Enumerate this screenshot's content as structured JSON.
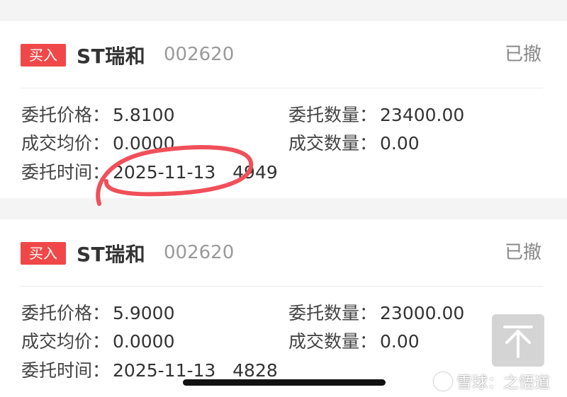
{
  "orders": [
    {
      "side": "买入",
      "name": "ST瑞和",
      "code": "002620",
      "status": "已撤",
      "price_label": "委托价格：",
      "price": "5.8100",
      "qty_label": "委托数量：",
      "qty": "23400.00",
      "avg_label": "成交均价：",
      "avg": "0.0000",
      "filled_label": "成交数量：",
      "filled": "0.00",
      "time_label": "委托时间：",
      "time": "2025-11-13   4949"
    },
    {
      "side": "买入",
      "name": "ST瑞和",
      "code": "002620",
      "status": "已撤",
      "price_label": "委托价格：",
      "price": "5.9000",
      "qty_label": "委托数量：",
      "qty": "23000.00",
      "avg_label": "成交均价：",
      "avg": "0.0000",
      "filled_label": "成交数量：",
      "filled": "0.00",
      "time_label": "委托时间：",
      "time": "2025-11-13   4828"
    }
  ],
  "watermark": "雪球：之悟道",
  "colors": {
    "badge": "#f04848",
    "annotation": "#f0505a",
    "status_text": "#888888"
  }
}
